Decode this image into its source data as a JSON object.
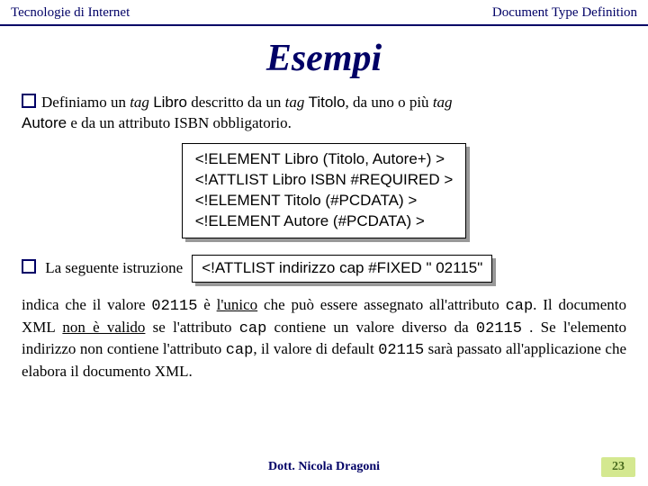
{
  "header": {
    "left": "Tecnologie di Internet",
    "right": "Document Type Definition"
  },
  "title": "Esempi",
  "para1": {
    "t1": "Definiamo un ",
    "tag1_i": "tag",
    "t2": " ",
    "libro": "Libro",
    "t3": " descritto da un ",
    "tag2_i": "tag",
    "t4": " ",
    "titolo": "Titolo",
    "t5": ", da uno o più ",
    "tag3_i": "tag",
    "t6": " ",
    "autore": "Autore",
    "t7": " e da un attributo ISBN obbligatorio."
  },
  "codebox1": {
    "l1": "<!ELEMENT Libro (Titolo, Autore+) >",
    "l2": "<!ATTLIST Libro ISBN #REQUIRED >",
    "l3": "<!ELEMENT Titolo (#PCDATA) >",
    "l4": "<!ELEMENT Autore (#PCDATA) >"
  },
  "para2_lead": "La seguente istruzione",
  "codebox2": "<!ATTLIST indirizzo cap #FIXED \" 02115\"",
  "para3": {
    "a": "indica che il valore ",
    "v1": "02115",
    "b": " è ",
    "u1": "l'unico",
    "c": " che può essere assegnato all'attributo ",
    "cap1": "cap",
    "d": ". Il documento XML ",
    "u2": "non è valido",
    "e": " se l'attributo ",
    "cap2": "cap",
    "f": " contiene un valore diverso da ",
    "v2": "02115",
    "g": " . Se l'elemento indirizzo non contiene l'attributo ",
    "cap3": "cap",
    "h": ", il valore di default ",
    "v3": "02115",
    "i": " sarà passato all'applicazione che elabora il documento XML."
  },
  "footer": {
    "author": "Dott. Nicola Dragoni",
    "page": "23"
  }
}
